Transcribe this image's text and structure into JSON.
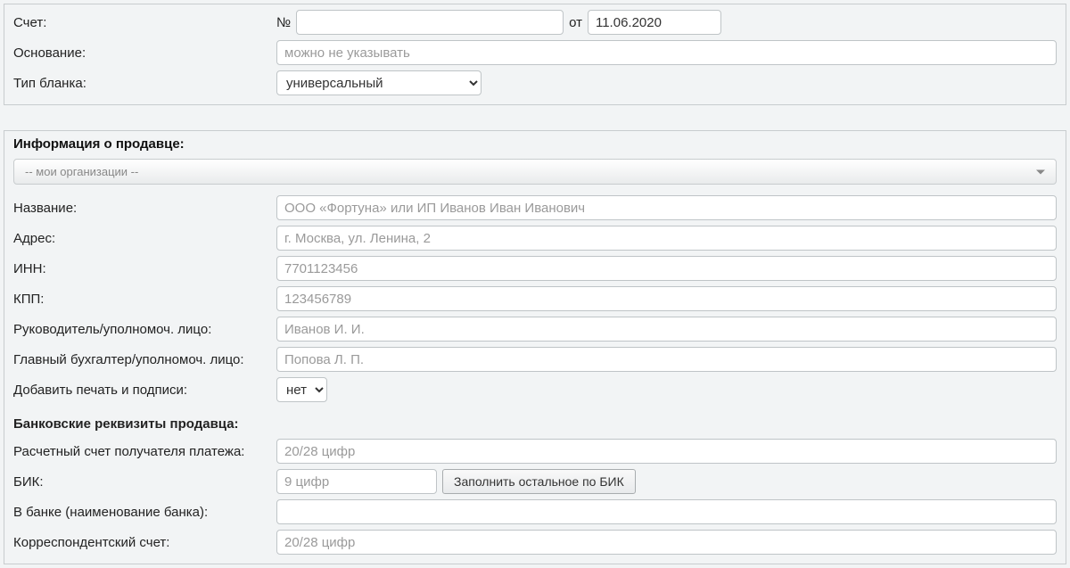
{
  "invoice": {
    "label": "Счет:",
    "number_prefix": "№",
    "number_value": "",
    "date_prefix": "от",
    "date_value": "11.06.2020"
  },
  "basis": {
    "label": "Основание:",
    "placeholder": "можно не указывать",
    "value": ""
  },
  "blank_type": {
    "label": "Тип бланка:",
    "selected": "универсальный",
    "options": [
      "универсальный"
    ]
  },
  "seller": {
    "section_title": "Информация о продавце:",
    "org_dropdown": "-- мои организации --",
    "name": {
      "label": "Название:",
      "placeholder": "ООО «Фортуна» или ИП Иванов Иван Иванович",
      "value": ""
    },
    "address": {
      "label": "Адрес:",
      "placeholder": "г. Москва, ул. Ленина, 2",
      "value": ""
    },
    "inn": {
      "label": "ИНН:",
      "placeholder": "7701123456",
      "value": ""
    },
    "kpp": {
      "label": "КПП:",
      "placeholder": "123456789",
      "value": ""
    },
    "director": {
      "label": "Руководитель/уполномоч. лицо:",
      "placeholder": "Иванов И. И.",
      "value": ""
    },
    "accountant": {
      "label": "Главный бухгалтер/уполномоч. лицо:",
      "placeholder": "Попова Л. П.",
      "value": ""
    },
    "stamp": {
      "label": "Добавить печать и подписи:",
      "selected": "нет",
      "options": [
        "нет"
      ]
    }
  },
  "bank": {
    "section_title": "Банковские реквизиты продавца:",
    "account": {
      "label": "Расчетный счет получателя платежа:",
      "placeholder": "20/28 цифр",
      "value": ""
    },
    "bik": {
      "label": "БИК:",
      "placeholder": "9 цифр",
      "value": "",
      "button": "Заполнить остальное по БИК"
    },
    "bank_name": {
      "label": "В банке (наименование банка):",
      "placeholder": "",
      "value": ""
    },
    "corr_account": {
      "label": "Корреспондентский счет:",
      "placeholder": "20/28 цифр",
      "value": ""
    }
  }
}
